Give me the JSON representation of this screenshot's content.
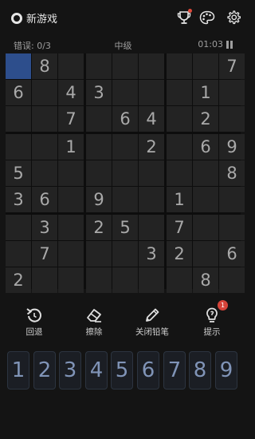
{
  "header": {
    "title": "新游戏",
    "icons": [
      "new-game-icon",
      "trophy-icon",
      "palette-icon",
      "gear-icon"
    ],
    "notification_color": "#e0493a"
  },
  "status": {
    "errors": "错误: 0/3",
    "difficulty": "中级",
    "timer": "01:03"
  },
  "board": {
    "grid": [
      [
        0,
        8,
        0,
        0,
        0,
        0,
        0,
        0,
        7
      ],
      [
        6,
        0,
        4,
        3,
        0,
        0,
        0,
        1,
        0
      ],
      [
        0,
        0,
        7,
        0,
        6,
        4,
        0,
        2,
        0
      ],
      [
        0,
        0,
        1,
        0,
        0,
        2,
        0,
        6,
        9
      ],
      [
        5,
        0,
        0,
        0,
        0,
        0,
        0,
        0,
        8
      ],
      [
        3,
        6,
        0,
        9,
        0,
        0,
        1,
        0,
        0
      ],
      [
        0,
        3,
        0,
        2,
        5,
        0,
        7,
        0,
        0
      ],
      [
        0,
        7,
        0,
        0,
        0,
        3,
        2,
        0,
        6
      ],
      [
        2,
        0,
        0,
        0,
        0,
        0,
        0,
        8,
        0
      ]
    ],
    "selected": [
      0,
      0
    ],
    "selected_color": "#2d4e8c"
  },
  "tools": {
    "undo": "回退",
    "erase": "擦除",
    "pencil": "关闭铅笔",
    "hint": "提示",
    "hint_badge": "1"
  },
  "numpad": [
    "1",
    "2",
    "3",
    "4",
    "5",
    "6",
    "7",
    "8",
    "9"
  ]
}
